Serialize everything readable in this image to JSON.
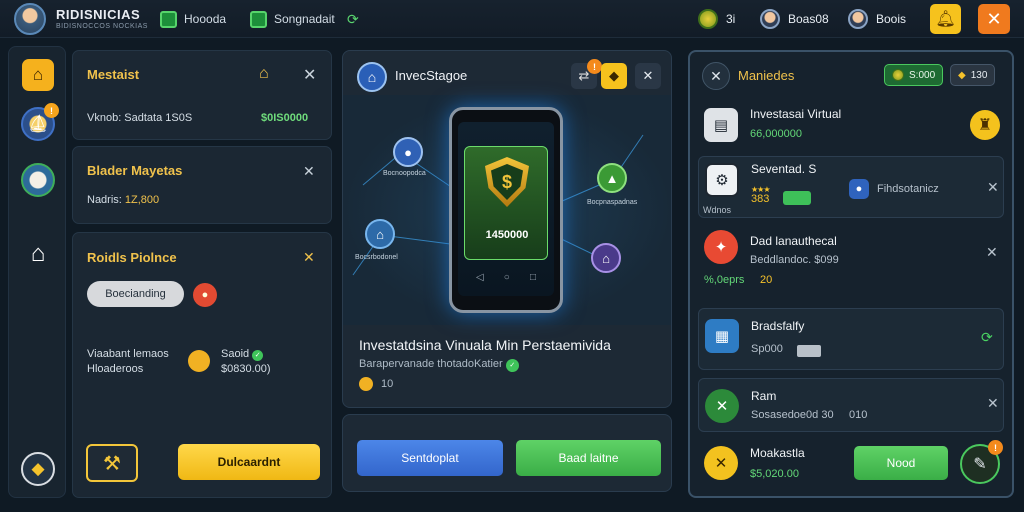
{
  "topbar": {
    "brand": "RIDISNICIAS",
    "brand_sub": "BIDISNOCCOS NOCKIAS",
    "nav": [
      "Hoooda",
      "Songnadait"
    ],
    "stats": [
      {
        "icon": "coin-icon",
        "value": "3i"
      },
      {
        "icon": "avatar-icon",
        "value": "Boas08"
      },
      {
        "icon": "avatar-icon",
        "value": "Boois"
      }
    ]
  },
  "col1": {
    "card1": {
      "title": "Mestaist",
      "label": "Vknob: Sadtata 1S0S",
      "value": "$0IS0000"
    },
    "card2": {
      "title": "Blader Mayetas",
      "label": "Nadris: ",
      "value": "1Z,800"
    },
    "card3": {
      "title": "Roidls Piolnce",
      "pill": "Boecianding",
      "left_lines": [
        "Viaabant lemaos",
        "Hloaderoos"
      ],
      "right_lines": [
        "Saoid",
        "$0830.00)"
      ],
      "button": "Dulcaardnt"
    }
  },
  "center": {
    "title": "InvecStagoe",
    "phone_amount": "1450000",
    "phone_symbol": "$",
    "nodes": [
      "Bocnoopodca",
      "Bocsrbodonel",
      "Bocpnaspadnas"
    ],
    "headline": "Investatdsina Vinuala Min Perstaemivida",
    "subline": "Barapervanade thotadoKatier",
    "count": "10",
    "btn_left": "Sentdoplat",
    "btn_right": "Baad laitne"
  },
  "right": {
    "title": "Maniedes",
    "pill1": "S:000",
    "pill2": "130",
    "items": [
      {
        "title": "Investasai Virtual",
        "sub": "66,000000"
      },
      {
        "title": "Seventad. S",
        "sub": "383",
        "extra": "Fihdsotanicz",
        "tag": "Wdnos"
      },
      {
        "title": "Dad lanauthecal",
        "sub": "Beddlandoc. $099",
        "sub2": "%,0eprs",
        "value": "20"
      },
      {
        "title": "Bradsfalfy",
        "sub": "Sp000"
      },
      {
        "title": "Ram",
        "sub": "Sosasedoe0d 30",
        "extra": "010"
      },
      {
        "title": "Moakastla",
        "sub": "$5,020.00",
        "btn": "Nood"
      }
    ]
  },
  "colors": {
    "accent_gold": "#f0c24c",
    "accent_green": "#5fd266",
    "accent_blue": "#4c86e8"
  }
}
